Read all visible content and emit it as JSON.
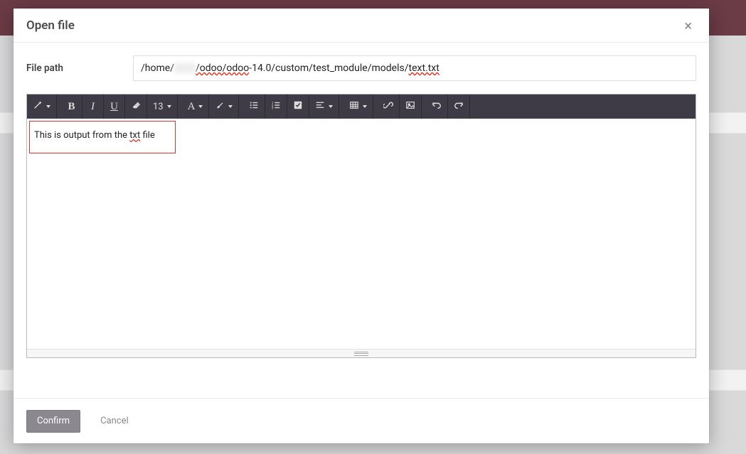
{
  "modal": {
    "title": "Open file",
    "close_aria": "Close"
  },
  "field": {
    "label": "File path",
    "value_pre": "/home/",
    "value_blur": "      ",
    "value_post": "/odoo/odoo-14.0/custom/test_module/models/text.txt"
  },
  "toolbar": {
    "font_size": "13"
  },
  "editor": {
    "content_pre": "This is output from the ",
    "content_spell": "txt",
    "content_post": " file"
  },
  "footer": {
    "confirm": "Confirm",
    "cancel": "Cancel"
  }
}
